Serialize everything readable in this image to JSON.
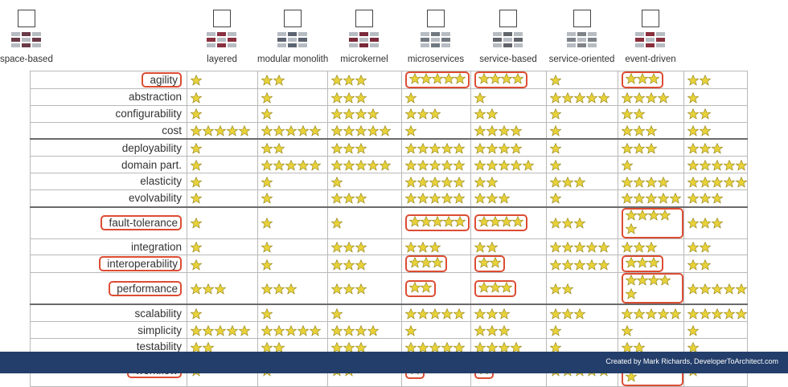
{
  "styles": [
    "layered",
    "modular monolith",
    "microkernel",
    "microservices",
    "service-based",
    "service-oriented",
    "event-driven",
    "space-based"
  ],
  "rows": [
    {
      "label": "agility",
      "ratings": [
        1,
        2,
        3,
        5,
        4,
        1,
        3,
        2
      ],
      "highlight": [
        false,
        false,
        false,
        true,
        true,
        false,
        true,
        false
      ],
      "label_highlight": true
    },
    {
      "label": "abstraction",
      "ratings": [
        1,
        1,
        3,
        1,
        1,
        5,
        4,
        1
      ],
      "highlight": [
        false,
        false,
        false,
        false,
        false,
        false,
        false,
        false
      ],
      "label_highlight": false
    },
    {
      "label": "configurability",
      "ratings": [
        1,
        1,
        4,
        3,
        2,
        1,
        2,
        2
      ],
      "highlight": [
        false,
        false,
        false,
        false,
        false,
        false,
        false,
        false
      ],
      "label_highlight": false
    },
    {
      "label": "cost",
      "ratings": [
        5,
        5,
        5,
        1,
        4,
        1,
        3,
        2
      ],
      "highlight": [
        false,
        false,
        false,
        false,
        false,
        false,
        false,
        false
      ],
      "label_highlight": false
    },
    {
      "label": "deployability",
      "ratings": [
        1,
        2,
        3,
        5,
        4,
        1,
        3,
        3
      ],
      "highlight": [
        false,
        false,
        false,
        false,
        false,
        false,
        false,
        false
      ],
      "label_highlight": false
    },
    {
      "label": "domain part.",
      "ratings": [
        1,
        5,
        5,
        5,
        5,
        1,
        1,
        5
      ],
      "highlight": [
        false,
        false,
        false,
        false,
        false,
        false,
        false,
        false
      ],
      "label_highlight": false
    },
    {
      "label": "elasticity",
      "ratings": [
        1,
        1,
        1,
        5,
        2,
        3,
        4,
        5
      ],
      "highlight": [
        false,
        false,
        false,
        false,
        false,
        false,
        false,
        false
      ],
      "label_highlight": false
    },
    {
      "label": "evolvability",
      "ratings": [
        1,
        1,
        3,
        5,
        3,
        1,
        5,
        3
      ],
      "highlight": [
        false,
        false,
        false,
        false,
        false,
        false,
        false,
        false
      ],
      "label_highlight": false
    },
    {
      "label": "fault-tolerance",
      "ratings": [
        1,
        1,
        1,
        5,
        4,
        3,
        5,
        3
      ],
      "highlight": [
        false,
        false,
        false,
        true,
        true,
        false,
        true,
        false
      ],
      "label_highlight": true
    },
    {
      "label": "integration",
      "ratings": [
        1,
        1,
        3,
        3,
        2,
        5,
        3,
        2
      ],
      "highlight": [
        false,
        false,
        false,
        false,
        false,
        false,
        false,
        false
      ],
      "label_highlight": false
    },
    {
      "label": "interoperability",
      "ratings": [
        1,
        1,
        3,
        3,
        2,
        5,
        3,
        2
      ],
      "highlight": [
        false,
        false,
        false,
        true,
        true,
        false,
        true,
        false
      ],
      "label_highlight": true
    },
    {
      "label": "performance",
      "ratings": [
        3,
        3,
        3,
        2,
        3,
        2,
        5,
        5
      ],
      "highlight": [
        false,
        false,
        false,
        true,
        true,
        false,
        true,
        false
      ],
      "label_highlight": true
    },
    {
      "label": "scalability",
      "ratings": [
        1,
        1,
        1,
        5,
        3,
        3,
        5,
        5
      ],
      "highlight": [
        false,
        false,
        false,
        false,
        false,
        false,
        false,
        false
      ],
      "label_highlight": false
    },
    {
      "label": "simplicity",
      "ratings": [
        5,
        5,
        4,
        1,
        3,
        1,
        1,
        1
      ],
      "highlight": [
        false,
        false,
        false,
        false,
        false,
        false,
        false,
        false
      ],
      "label_highlight": false
    },
    {
      "label": "testability",
      "ratings": [
        2,
        2,
        3,
        5,
        4,
        1,
        2,
        1
      ],
      "highlight": [
        false,
        false,
        false,
        false,
        false,
        false,
        false,
        false
      ],
      "label_highlight": false
    },
    {
      "label": "workflow",
      "ratings": [
        1,
        1,
        2,
        1,
        1,
        5,
        5,
        1
      ],
      "highlight": [
        false,
        false,
        false,
        true,
        true,
        false,
        true,
        false
      ],
      "label_highlight": true
    }
  ],
  "separators_before": [
    4,
    8,
    12
  ],
  "footer": {
    "credit": "Created by Mark Richards, DeveloperToArchitect.com"
  },
  "colors": {
    "highlight": "#dc4d33",
    "star": "#e8d23a",
    "footer": "#233e6a"
  }
}
